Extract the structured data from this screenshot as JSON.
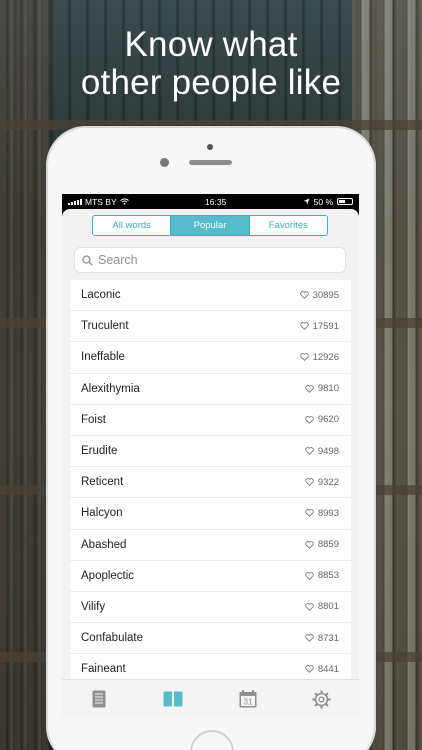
{
  "headline": {
    "line1": "Know what",
    "line2": "other people like"
  },
  "status_bar": {
    "carrier": "MTS BY",
    "time": "16:35",
    "battery": "50 %"
  },
  "segments": [
    {
      "label": "All words",
      "active": false
    },
    {
      "label": "Popular",
      "active": true
    },
    {
      "label": "Favorites",
      "active": false
    }
  ],
  "search": {
    "placeholder": "Search"
  },
  "words": [
    {
      "word": "Laconic",
      "likes": "30895"
    },
    {
      "word": "Truculent",
      "likes": "17591"
    },
    {
      "word": "Ineffable",
      "likes": "12926"
    },
    {
      "word": "Alexithymia",
      "likes": "9810"
    },
    {
      "word": "Foist",
      "likes": "9620"
    },
    {
      "word": "Erudite",
      "likes": "9498"
    },
    {
      "word": "Reticent",
      "likes": "9322"
    },
    {
      "word": "Halcyon",
      "likes": "8993"
    },
    {
      "word": "Abashed",
      "likes": "8859"
    },
    {
      "word": "Apoplectic",
      "likes": "8853"
    },
    {
      "word": "Vilify",
      "likes": "8801"
    },
    {
      "word": "Confabulate",
      "likes": "8731"
    },
    {
      "word": "Faineant",
      "likes": "8441"
    }
  ],
  "tabbar": {
    "tabs": [
      {
        "icon": "document-icon",
        "active": false
      },
      {
        "icon": "book-icon",
        "active": true
      },
      {
        "icon": "calendar-icon",
        "active": false,
        "day": "31"
      },
      {
        "icon": "gear-icon",
        "active": false
      }
    ]
  },
  "colors": {
    "accent": "#56bccb",
    "inactive_tab": "#8e8e93"
  }
}
